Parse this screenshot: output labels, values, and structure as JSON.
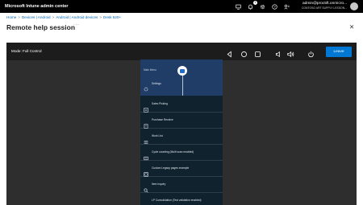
{
  "topbar": {
    "app_title": "Microsoft Intune admin center",
    "notification_count": "1",
    "account_email": "admin@proc5ft.onmicro...",
    "account_org": "CONTOSO ART SUPPLY LESSON...",
    "icons": [
      "monitor-icon",
      "bell-icon",
      "gear-icon",
      "help-icon",
      "feedback-icon"
    ]
  },
  "breadcrumb": {
    "items": [
      "Home",
      "Devices | Android",
      "Android | Android devices",
      "Desk 520+"
    ],
    "separator": ">"
  },
  "page": {
    "title": "Remote help session",
    "more": "···",
    "close": "✕"
  },
  "session": {
    "mode_label": "Mode: Full Control",
    "leave_label": "Leave",
    "controls": [
      "back-icon",
      "home-icon",
      "recents-icon",
      "volume-down-icon",
      "volume-up-icon",
      "power-icon"
    ]
  },
  "device": {
    "main_menu": "Main Menu",
    "settings": "Settings",
    "items": [
      "Sales Picking",
      "Purchase Receive",
      "Work List",
      "Cycle counting (Multi scan enabled)",
      "Custom Legacy pages example",
      "Item Inquiry",
      "LP Consolidation (Test validation enabled)"
    ]
  },
  "colors": {
    "topbar": "#000000",
    "session_bg": "#2e2e2e",
    "session_bar": "#1c1c1c",
    "leave_button": "#0078d4",
    "phone_bg": "#10222e",
    "phone_header": "#1f3d66",
    "link": "#0067b8"
  }
}
